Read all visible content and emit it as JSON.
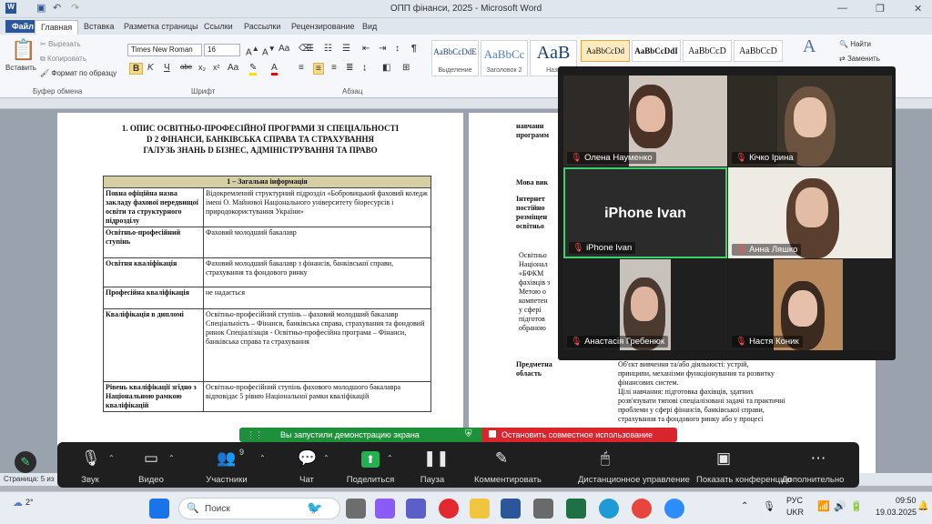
{
  "window": {
    "title": "ОПП фінанси, 2025 - Microsoft Word"
  },
  "ribbon": {
    "tabs": {
      "file": "Файл",
      "home": "Главная",
      "insert": "Вставка",
      "page_layout": "Разметка страницы",
      "links": "Ссылки",
      "mailings": "Рассылки",
      "review": "Рецензирование",
      "view": "Вид"
    },
    "clipboard": {
      "paste": "Вставить",
      "cut": "Вырезать",
      "copy": "Копировать",
      "format_painter": "Формат по образцу",
      "group": "Буфер обмена"
    },
    "font": {
      "name": "Times New Roman",
      "size": "16",
      "group": "Шрифт"
    },
    "paragraph": {
      "group": "Абзац"
    },
    "styles": [
      {
        "sample": "AaBbCcDdE",
        "name": "Выделение"
      },
      {
        "sample": "AaBbCc",
        "name": "Заголовок 2"
      },
      {
        "sample": "AaB",
        "name": "Назв"
      },
      {
        "sample": "AaBbCcDd",
        "name": ""
      },
      {
        "sample": "AaBbCcDdI",
        "name": ""
      },
      {
        "sample": "AaBbCcD",
        "name": ""
      },
      {
        "sample": "AaBbCcD",
        "name": ""
      }
    ],
    "editing": {
      "find": "Найти",
      "replace": "Заменить"
    }
  },
  "document": {
    "heading_lines": [
      "1.  ОПИС ОСВІТНЬО-ПРОФЕСІЙНОЇ ПРОГРАМИ ЗІ СПЕЦІАЛЬНОСТІ",
      "D 2 ФІНАНСИ, БАНКІВСЬКА СПРАВА ТА СТРАХУВАННЯ",
      "ГАЛУЗЬ ЗНАНЬ D БІЗНЕС, АДМІНІСТРУВАННЯ ТА ПРАВО"
    ],
    "table_header": "1 – Загальна інформація",
    "rows": [
      {
        "label": "Повна офіційна назва закладу фахової передвищої освіти та структурного підрозділу",
        "value": "Відокремлений структурний підрозділ «Бобровицький фаховий коледж імені О. Майнової Національного університету біоресурсів і природокористування України»"
      },
      {
        "label": "Освітньо-професійний ступінь",
        "value": "Фаховий молодший бакалавр"
      },
      {
        "label": "Освітня кваліфікація",
        "value": "Фаховий молодший бакалавр з фінансів, банківської справи, страхування та фондового ринку"
      },
      {
        "label": "Професійна кваліфікація",
        "value": "не надається"
      },
      {
        "label": "Кваліфікація в дипломі",
        "value": "Освітньо-професійний ступінь – фаховий молодший бакалавр Спеціальність – Фінанси, банківська справа, страхування та фондовий ринок Спеціалізація - Освітньо-професійна програма – Фінанси, банківська справа та страхування"
      },
      {
        "label": "Рівень кваліфікації згідно з Національною рамкою кваліфікацій",
        "value": "Освітньо-професійний ступінь фахового молодшого бакалавра відповідає 5 рівню Національної рамки кваліфікацій"
      }
    ],
    "right_page": {
      "label1": "навчанн программ",
      "label2": "Мова вик",
      "label3": "Інтернет постійно розміщен освітньо",
      "frag_lines": [
        "Освітньо",
        "Націонал",
        "«БФКМ",
        "фахівців з",
        "Метою о",
        "компетен",
        "у сфері",
        "підготов",
        "обраною"
      ],
      "subject_label": "Предметна область",
      "subject_lines": [
        "Об'єкт вивчення та/або діяльності: устрій,",
        "принципи, механізми функціонування та розвитку",
        "фінансових систем.",
        "Цілі навчання: підготовка фахівців, здатних",
        "розв'язувати типові спеціалізовані задачі та практичні",
        "проблеми у сфері фінансів, банківської справи,",
        "страхування та фондового ринку або у процесі"
      ]
    }
  },
  "status": {
    "page": "Страница: 5 из"
  },
  "zoom": {
    "participants": [
      {
        "name": "Олена Науменко"
      },
      {
        "name": "Кічко Ірина"
      },
      {
        "name": "iPhone Ivan",
        "video_text": "iPhone Ivan"
      },
      {
        "name": "Анна Ляшко"
      },
      {
        "name": "Анастасія Гребенюк"
      },
      {
        "name": "Настя Коник"
      }
    ],
    "share_banner": "Вы запустили демонстрацию экрана",
    "stop_banner": "Остановить совместное использование",
    "toolbar": {
      "audio": "Звук",
      "video": "Видео",
      "participants": "Участники",
      "participants_count": "9",
      "chat": "Чат",
      "share": "Поделиться",
      "pause": "Пауза",
      "annotate": "Комментировать",
      "remote_control": "Дистанционное управление",
      "show_conference": "Показать конференцию",
      "more": "Дополнительно"
    }
  },
  "taskbar": {
    "weather": "2°",
    "search": "Поиск",
    "lang1": "РУС",
    "lang2": "UKR",
    "time": "09:50",
    "date": "19.03.2025"
  }
}
